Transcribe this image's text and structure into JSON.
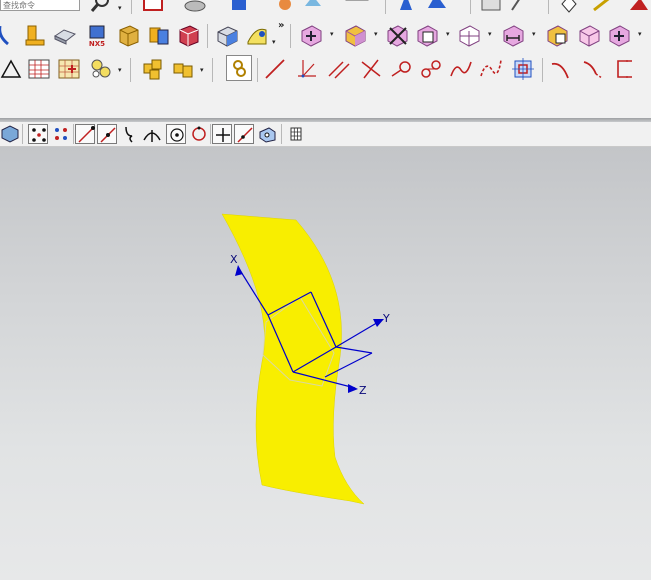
{
  "command_finder": {
    "placeholder": "查找命令"
  },
  "toolbar": {
    "row1": [
      "search-icon",
      "move-object-icon",
      "extrude-icon",
      "shade-icon",
      "pattern-icon",
      "blank-box-icon",
      "feature-icon",
      "sheet-icon",
      "layer-icon",
      "view-icon",
      "snap-icon",
      "assembly-icon"
    ],
    "row2": [
      "curve-icon",
      "extrude-icon",
      "block-icon",
      "nx5-icon",
      "tube-icon",
      "unite-icon",
      "cube-icon",
      "sweep-icon",
      "surface-icon",
      "offset-face-icon",
      "trim-body-icon",
      "split-body-icon",
      "box-dot-icon",
      "measure-icon",
      "wave-icon",
      "section-icon",
      "move-face-icon"
    ],
    "row3": [
      "triangle-icon",
      "table-icon",
      "grid-sketch-icon",
      "feature-group-icon",
      "assembly-add-icon",
      "assembly-parts-icon",
      "lock-icon",
      "line-icon",
      "point-icon",
      "parallel-line-icon",
      "intersect-line-icon",
      "circle-line-icon",
      "double-circle-icon",
      "spline-icon",
      "studio-spline-icon",
      "project-icon",
      "arc-icon",
      "trim-curve-icon",
      "bracket-icon"
    ],
    "nx5_label": "NX5"
  },
  "selection_bar": {
    "items": [
      "solid-filter-icon",
      "all-points-icon",
      "control-point-icon",
      "end-point-icon",
      "mid-point-icon",
      "curve-point-icon",
      "intersection-icon",
      "center-icon",
      "quadrant-icon",
      "existing-point-icon",
      "point-on-curve-icon",
      "point-on-face-icon",
      "grid-icon"
    ]
  },
  "viewport": {
    "axis_x": "X",
    "axis_y": "Y",
    "axis_z": "Z",
    "surface_color": "#f8ee00",
    "axis_color": "#0000cc"
  }
}
